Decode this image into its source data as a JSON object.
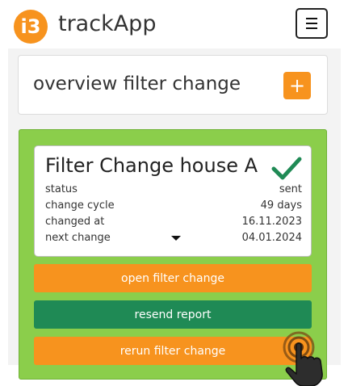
{
  "app": {
    "logo_text": "i3",
    "title": "trackApp"
  },
  "overview": {
    "title": "overview filter change",
    "add_label": "+"
  },
  "filter_card": {
    "title": "Filter Change house A",
    "rows": [
      {
        "label": "status",
        "value": "sent"
      },
      {
        "label": "change cycle",
        "value": "49 days"
      },
      {
        "label": "changed at",
        "value": "16.11.2023"
      },
      {
        "label": "next change",
        "value": "04.01.2024"
      }
    ]
  },
  "buttons": {
    "open": "open filter change",
    "resend": "resend report",
    "rerun": "rerun filter change"
  },
  "colors": {
    "orange": "#f7931e",
    "green_panel": "#8bce4b",
    "dark_green": "#1f8a55",
    "check": "#1f8a55"
  },
  "icons": [
    "menu-icon",
    "plus-icon",
    "checkmark-icon",
    "caret-down-icon",
    "pointer-hand-icon"
  ]
}
